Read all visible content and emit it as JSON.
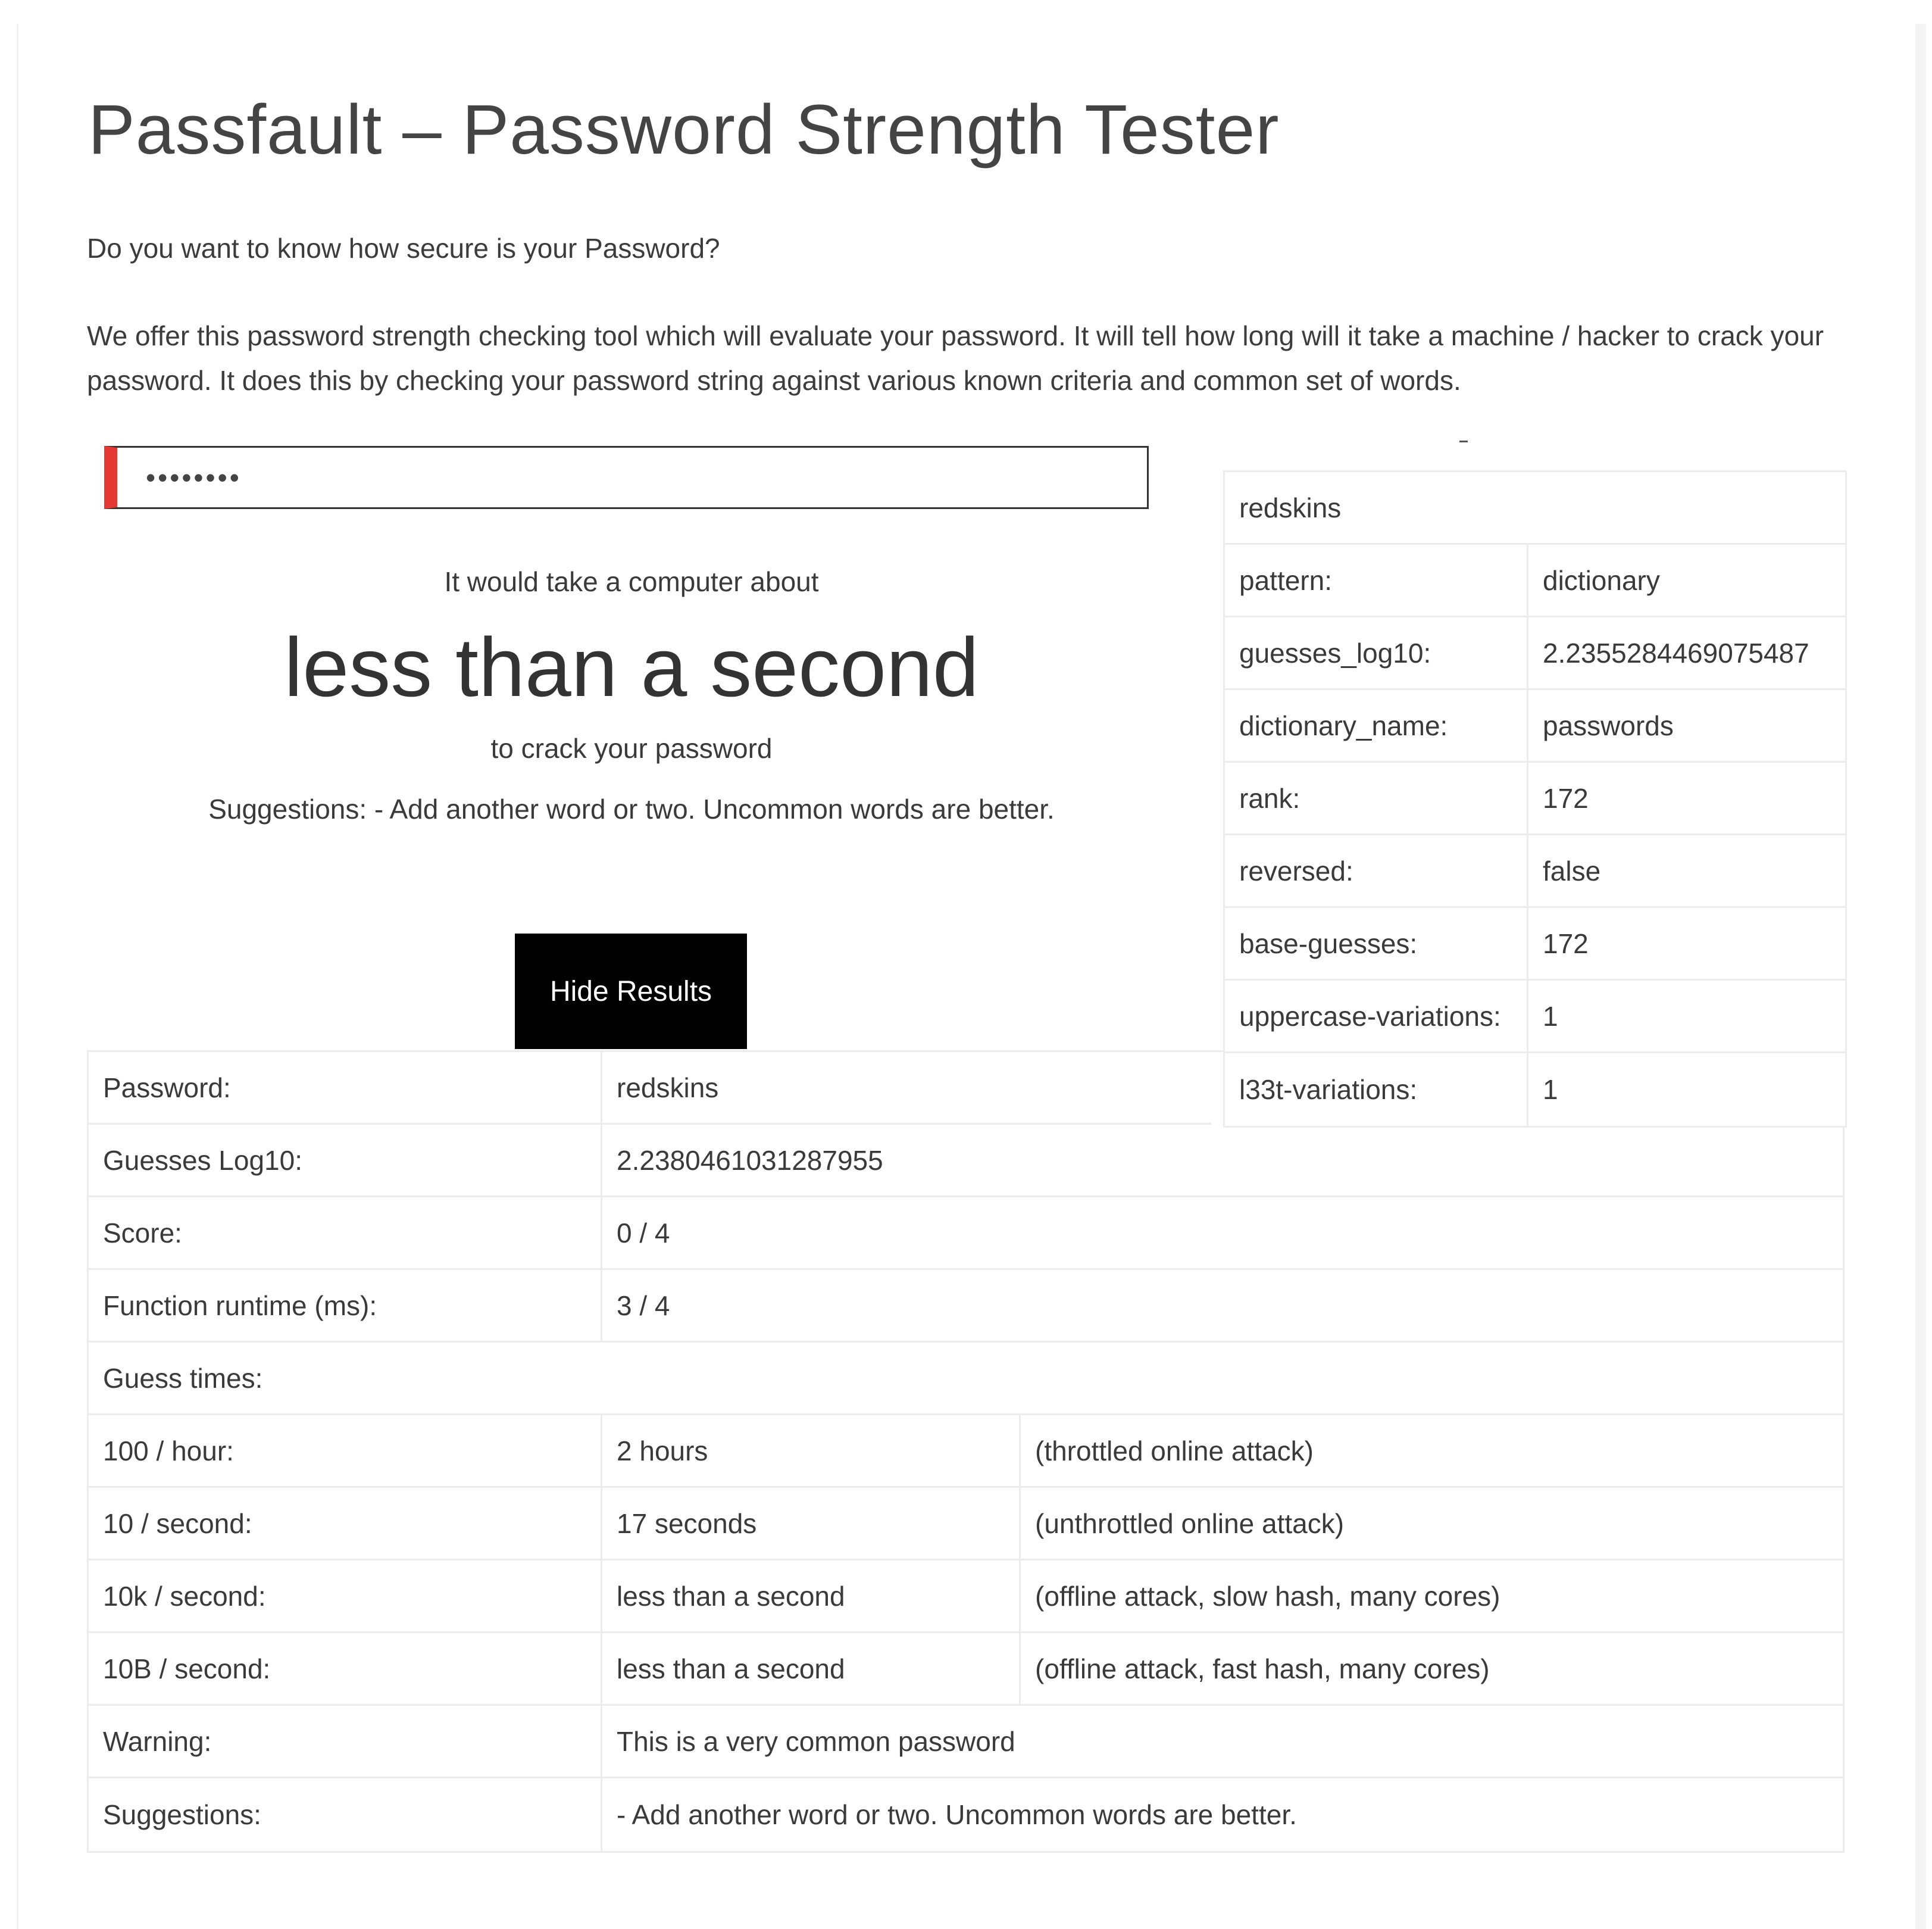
{
  "title": "Passfault – Password Strength Tester",
  "intro": "Do you want to know how secure is your Password?",
  "description": "We offer this password strength checking tool which will evaluate your password. It will tell how long will it take a machine / hacker to crack your password. It does this by checking your password string against various known criteria and common set of words.",
  "password_field": {
    "value": "redskins",
    "strength_color": "#e53935"
  },
  "result": {
    "prefix": "It would take a computer about",
    "time": "less than a second",
    "suffix": "to crack your password",
    "suggestions": "Suggestions: - Add another word or two. Uncommon words are better."
  },
  "hide_button": "Hide Results",
  "match_table": {
    "token": "redskins",
    "rows": [
      {
        "k": "pattern:",
        "v": "dictionary"
      },
      {
        "k": "guesses_log10:",
        "v": "2.2355284469075487"
      },
      {
        "k": "dictionary_name:",
        "v": "passwords"
      },
      {
        "k": "rank:",
        "v": "172"
      },
      {
        "k": "reversed:",
        "v": "false"
      },
      {
        "k": "base-guesses:",
        "v": "172"
      },
      {
        "k": "uppercase-variations:",
        "v": "1"
      },
      {
        "k": "l33t-variations:",
        "v": "1"
      }
    ]
  },
  "results_table": {
    "password": {
      "k": "Password:",
      "v": "redskins"
    },
    "rows": [
      {
        "k": "Guesses Log10:",
        "v": "2.2380461031287955"
      },
      {
        "k": "Score:",
        "v": "0 / 4"
      },
      {
        "k": "Function runtime (ms):",
        "v": "3 / 4"
      }
    ],
    "guess_times_label": "Guess times:",
    "guess_times": [
      {
        "k": "100 / hour:",
        "v": "2 hours",
        "n": "(throttled online attack)"
      },
      {
        "k": "10  / second:",
        "v": "17 seconds",
        "n": "(unthrottled online attack)"
      },
      {
        "k": "10k / second:",
        "v": "less than a second",
        "n": "(offline attack, slow hash, many cores)"
      },
      {
        "k": "10B / second:",
        "v": "less than a second",
        "n": "(offline attack, fast hash, many cores)"
      }
    ],
    "warning": {
      "k": "Warning:",
      "v": "This is a very common password"
    },
    "suggestions": {
      "k": "Suggestions:",
      "v": "- Add another word or two. Uncommon words are better."
    }
  }
}
